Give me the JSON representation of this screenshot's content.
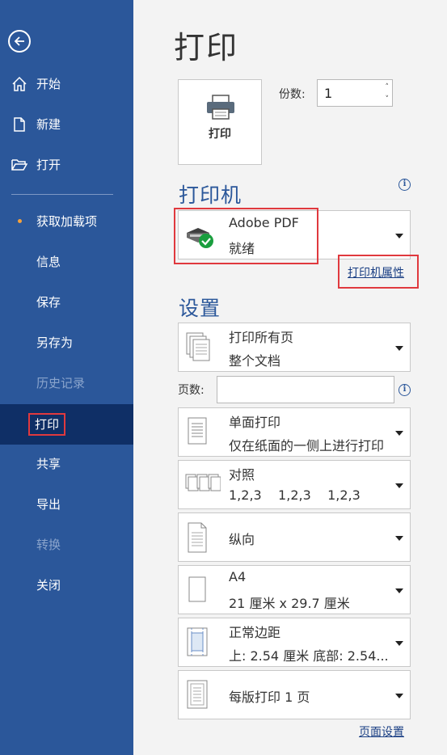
{
  "sidebar": {
    "items": [
      {
        "label": "开始",
        "icon": "home-icon",
        "enabled": true
      },
      {
        "label": "新建",
        "icon": "new-document-icon",
        "enabled": true
      },
      {
        "label": "打开",
        "icon": "folder-open-icon",
        "enabled": true
      },
      {
        "label": "获取加载项",
        "enabled": true,
        "has_dot": true
      },
      {
        "label": "信息",
        "enabled": true
      },
      {
        "label": "保存",
        "enabled": true
      },
      {
        "label": "另存为",
        "enabled": true
      },
      {
        "label": "历史记录",
        "enabled": false
      },
      {
        "label": "打印",
        "enabled": true,
        "active": true
      },
      {
        "label": "共享",
        "enabled": true
      },
      {
        "label": "导出",
        "enabled": true
      },
      {
        "label": "转换",
        "enabled": false
      },
      {
        "label": "关闭",
        "enabled": true
      }
    ],
    "back_icon": "back-arrow-icon"
  },
  "main": {
    "title": "打印",
    "print_button_label": "打印",
    "copies_label": "份数:",
    "copies_value": "1",
    "printer_section_title": "打印机",
    "printer": {
      "name": "Adobe PDF",
      "status": "就绪"
    },
    "printer_properties_link": "打印机属性",
    "settings_section_title": "设置",
    "settings": [
      {
        "line1": "打印所有页",
        "line2": "整个文档",
        "icon": "pages-stack-icon"
      },
      {
        "line1": "单面打印",
        "line2": "仅在纸面的一侧上进行打印",
        "icon": "one-sided-icon"
      },
      {
        "line1": "对照",
        "line2": "1,2,3    1,2,3    1,2,3",
        "icon": "collate-icon"
      },
      {
        "line1": "纵向",
        "line2": "",
        "icon": "portrait-icon"
      },
      {
        "line1": "A4",
        "line2": "21 厘米 x 29.7 厘米",
        "icon": "paper-size-icon"
      },
      {
        "line1": "正常边距",
        "line2": "上: 2.54 厘米 底部: 2.54...",
        "icon": "margins-icon"
      },
      {
        "line1": "每版打印 1 页",
        "line2": "",
        "icon": "pages-per-sheet-icon"
      }
    ],
    "pages_label": "页数:",
    "pages_value": "",
    "page_setup_link": "页面设置"
  },
  "colors": {
    "sidebar_bg": "#2b579a",
    "active_bg": "#0f2f66",
    "accent": "#2b579a",
    "highlight": "#e0393e"
  }
}
